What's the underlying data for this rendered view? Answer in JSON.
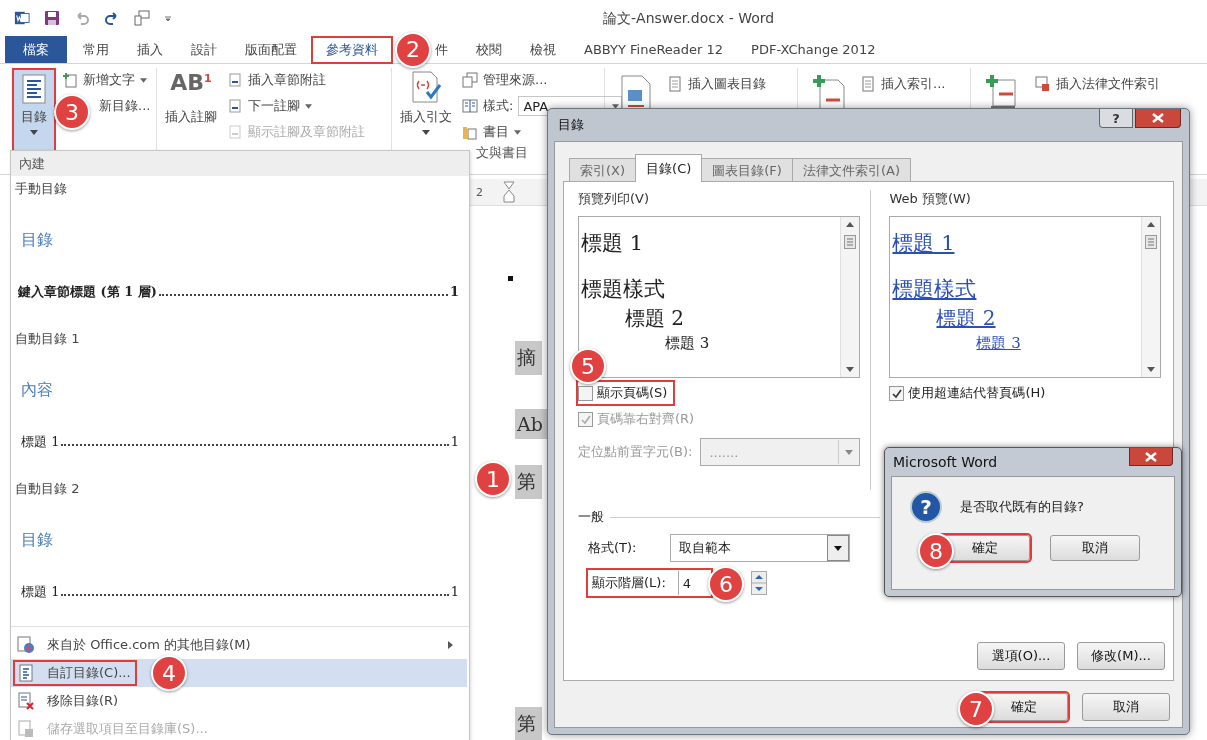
{
  "title_bar": {
    "title": "論文-Answer.docx - Word"
  },
  "tabs": [
    {
      "label": "檔案",
      "kind": "file",
      "selected": false,
      "highlighted": false
    },
    {
      "label": "常用",
      "kind": "tab",
      "selected": false,
      "highlighted": false
    },
    {
      "label": "插入",
      "kind": "tab",
      "selected": false,
      "highlighted": false
    },
    {
      "label": "設計",
      "kind": "tab",
      "selected": false,
      "highlighted": false
    },
    {
      "label": "版面配置",
      "kind": "tab",
      "selected": false,
      "highlighted": false
    },
    {
      "label": "參考資料",
      "kind": "tab",
      "selected": true,
      "highlighted": true,
      "step": "2"
    },
    {
      "label": "件",
      "kind": "tab",
      "selected": false,
      "highlighted": false
    },
    {
      "label": "校閱",
      "kind": "tab",
      "selected": false,
      "highlighted": false
    },
    {
      "label": "檢視",
      "kind": "tab",
      "selected": false,
      "highlighted": false
    },
    {
      "label": "ABBYY FineReader 12",
      "kind": "tab",
      "selected": false,
      "highlighted": false
    },
    {
      "label": "PDF-XChange 2012",
      "kind": "tab",
      "selected": false,
      "highlighted": false
    }
  ],
  "ribbon": {
    "toc_button": {
      "label": "目錄",
      "selected": true,
      "highlighted": true,
      "step": "3"
    },
    "toc_commands": [
      {
        "label": "新增文字",
        "dropdown": true
      },
      {
        "label": "新目錄...",
        "dropdown": false
      }
    ],
    "footnote_button": {
      "label": "插入註腳",
      "glyph": "AB",
      "mark": "1"
    },
    "footnote_commands": [
      {
        "label": "插入章節附註",
        "dropdown": false,
        "disabled": false
      },
      {
        "label": "下一註腳",
        "dropdown": true,
        "disabled": false
      },
      {
        "label": "顯示註腳及章節附註",
        "dropdown": false,
        "disabled": true
      }
    ],
    "citation_button": {
      "label": "插入引文"
    },
    "citation_commands": {
      "manage": "管理來源...",
      "style_label": "樣式:",
      "style_value": "APA",
      "bibliography": "書目"
    },
    "citation_group_label": "文與書目",
    "captions_command": "插入圖表目錄",
    "index_command": "插入索引...",
    "authorities_command": "插入法律文件索引"
  },
  "menu": {
    "header": "內建",
    "gallery": [
      {
        "name": "手動目錄",
        "heading": "目錄",
        "entry": "鍵入章節標題 (第 1 層)",
        "page": "1",
        "kind": "bold"
      },
      {
        "name": "自動目錄 1",
        "heading": "內容",
        "entry": "標題 1",
        "page": "1",
        "kind": "plain"
      },
      {
        "name": "自動目錄 2",
        "heading": "目錄",
        "entry": "標題 1",
        "page": "1",
        "kind": "plain"
      }
    ],
    "commands": [
      {
        "label": "來自於 Office.com 的其他目錄(M)",
        "kind": "web",
        "submenu": true,
        "selected": false,
        "disabled": false,
        "highlighted": false
      },
      {
        "label": "自訂目錄(C)...",
        "kind": "custom",
        "submenu": false,
        "selected": true,
        "disabled": false,
        "highlighted": true,
        "step": "4"
      },
      {
        "label": "移除目錄(R)",
        "kind": "remove",
        "submenu": false,
        "selected": false,
        "disabled": false,
        "highlighted": false
      },
      {
        "label": "儲存選取項目至目錄庫(S)...",
        "kind": "save",
        "submenu": false,
        "selected": false,
        "disabled": true,
        "highlighted": false
      }
    ]
  },
  "document": {
    "ruler_mark": "2",
    "paragraphs": [
      {
        "text": "摘"
      },
      {
        "text": "Ab"
      },
      {
        "text": "第",
        "step": "1"
      },
      {
        "text": "第"
      }
    ]
  },
  "dialog": {
    "title": "目錄",
    "help_label": "?",
    "tabs": [
      {
        "label": "索引(X)",
        "selected": false
      },
      {
        "label": "目錄(C)",
        "selected": true
      },
      {
        "label": "圖表目錄(F)",
        "selected": false
      },
      {
        "label": "法律文件索引(A)",
        "selected": false
      }
    ],
    "print_preview": {
      "label": "預覽列印(V)",
      "lines": [
        {
          "text": "標題 1",
          "kind": "heading1"
        },
        {
          "text": "標題樣式",
          "kind": "heading1"
        },
        {
          "text": "標題 2",
          "kind": "heading2"
        },
        {
          "text": "標題 3",
          "kind": "heading3"
        }
      ]
    },
    "web_preview": {
      "label": "Web 預覽(W)",
      "lines": [
        {
          "text": "標題 1",
          "kind": "heading1"
        },
        {
          "text": "標題樣式",
          "kind": "heading1"
        },
        {
          "text": "標題 2",
          "kind": "heading2"
        },
        {
          "text": "標題 3",
          "kind": "heading3"
        }
      ]
    },
    "show_page_numbers": {
      "label": "顯示頁碼(S)",
      "checked": false,
      "disabled": false,
      "highlighted": true,
      "step": "5"
    },
    "right_align": {
      "label": "頁碼靠右對齊(R)",
      "checked": true,
      "disabled": true,
      "highlighted": false
    },
    "tab_leader": {
      "label": "定位點前置字元(B):",
      "value": ".......",
      "disabled": true
    },
    "use_hyperlinks": {
      "label": "使用超連結代替頁碼(H)",
      "checked": true,
      "disabled": false,
      "highlighted": false
    },
    "general": {
      "label": "一般",
      "format_label": "格式(T):",
      "format_value": "取自範本",
      "levels_label": "顯示階層(L):",
      "levels_value": "4",
      "levels_highlighted": true,
      "levels_step": "6"
    },
    "option_buttons": [
      {
        "label": "選項(O)..."
      },
      {
        "label": "修改(M)..."
      }
    ],
    "footer_buttons": [
      {
        "label": "確定",
        "highlighted": true,
        "step": "7"
      },
      {
        "label": "取消",
        "highlighted": false
      }
    ]
  },
  "message_box": {
    "title": "Microsoft Word",
    "icon_glyph": "?",
    "message": "是否取代既有的目錄?",
    "buttons": [
      {
        "label": "確定",
        "highlighted": true,
        "step": "8"
      },
      {
        "label": "取消",
        "highlighted": false
      }
    ]
  }
}
